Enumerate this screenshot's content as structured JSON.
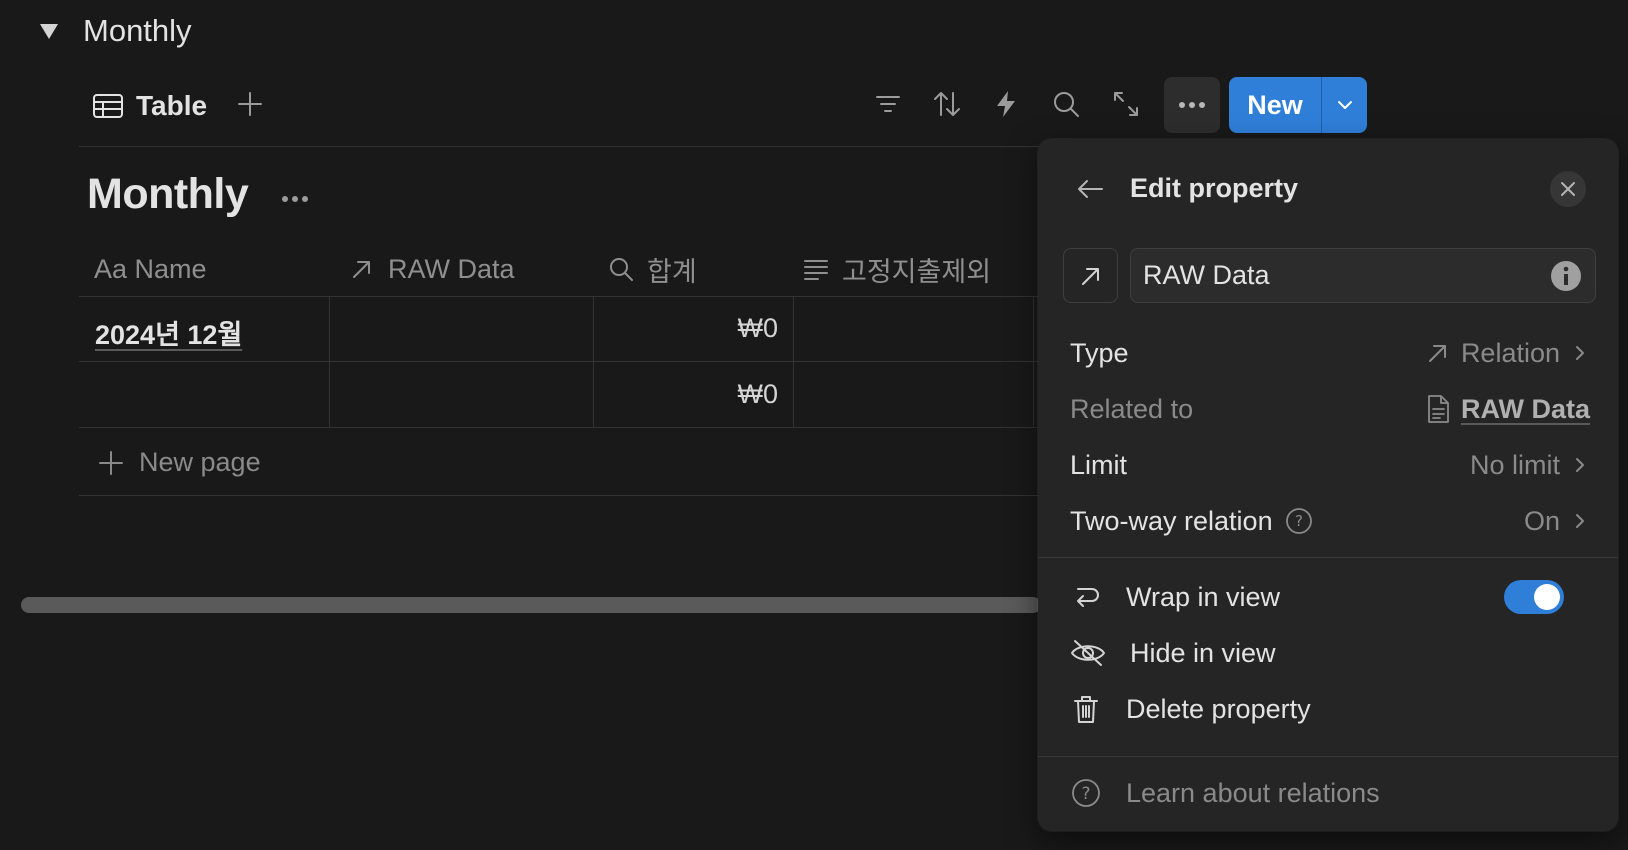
{
  "section": {
    "title": "Monthly"
  },
  "view_bar": {
    "tab_label": "Table",
    "new_label": "New"
  },
  "database": {
    "title": "Monthly",
    "columns": [
      {
        "label": "Aa Name",
        "icon": "text-icon"
      },
      {
        "label": "RAW Data",
        "icon": "relation-arrow-icon"
      },
      {
        "label": "합계",
        "icon": "search-icon"
      },
      {
        "label": "고정지출제외",
        "icon": "text-lines-icon"
      }
    ],
    "rows": [
      {
        "name": "2024년 12월",
        "raw_data": "",
        "total": "₩0",
        "fixed": ""
      },
      {
        "name": "",
        "raw_data": "",
        "total": "₩0",
        "fixed": ""
      }
    ],
    "new_page_label": "New page"
  },
  "panel": {
    "title": "Edit property",
    "property_name": "RAW Data",
    "rows": {
      "type": {
        "label": "Type",
        "value": "Relation"
      },
      "related_to": {
        "label": "Related to",
        "value": "RAW Data"
      },
      "limit": {
        "label": "Limit",
        "value": "No limit"
      },
      "two_way": {
        "label": "Two-way relation",
        "value": "On"
      }
    },
    "actions": {
      "wrap": "Wrap in view",
      "hide": "Hide in view",
      "delete": "Delete property"
    },
    "wrap_enabled": true,
    "learn": "Learn about relations"
  },
  "colors": {
    "background": "#191919",
    "panel": "#252525",
    "accent": "#2f7fd9"
  }
}
